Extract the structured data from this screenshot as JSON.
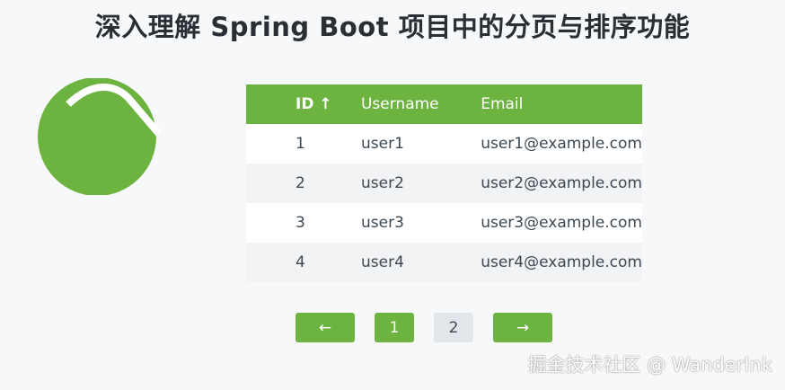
{
  "page": {
    "title": "深入理解 Spring Boot 项目中的分页与排序功能"
  },
  "logo": {
    "icon": "spring-logo-icon",
    "color": "#6db33f"
  },
  "table": {
    "headers": {
      "id": "ID ↑",
      "username": "Username",
      "email": "Email"
    },
    "rows": [
      {
        "id": "1",
        "username": "user1",
        "email": "user1@example.com"
      },
      {
        "id": "2",
        "username": "user2",
        "email": "user2@example.com"
      },
      {
        "id": "3",
        "username": "user3",
        "email": "user3@example.com"
      },
      {
        "id": "4",
        "username": "user4",
        "email": "user4@example.com"
      }
    ]
  },
  "pagination": {
    "prev_label": "←",
    "pages": [
      "1",
      "2"
    ],
    "current_page": "1",
    "next_label": "→"
  },
  "watermark": "掘金技术社区 @ WanderInk",
  "colors": {
    "accent": "#6db33f",
    "background": "#f6f8fa",
    "row_alt": "#f1f3f5",
    "inactive_button": "#e2e6ea"
  }
}
